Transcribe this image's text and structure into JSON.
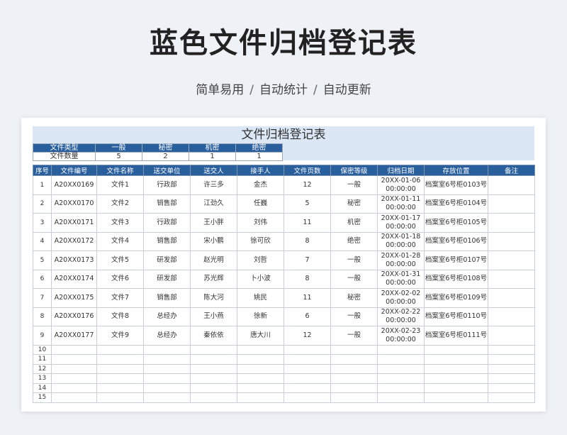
{
  "page_title": "蓝色文件归档登记表",
  "subtitle": [
    "简单易用",
    "自动统计",
    "自动更新"
  ],
  "subtitle_sep": "/",
  "sheet": {
    "banner": "文件归档登记表",
    "summary": {
      "header": [
        "文件类型",
        "一般",
        "秘密",
        "机密",
        "绝密"
      ],
      "values": [
        "文件数量",
        "5",
        "2",
        "1",
        "1"
      ]
    },
    "columns": [
      "序号",
      "文件编号",
      "文件名称",
      "送交单位",
      "送交人",
      "接手人",
      "文件页数",
      "保密等级",
      "归档日期",
      "存放位置",
      "备注"
    ],
    "rows": [
      [
        "1",
        "A20XX0169",
        "文件1",
        "行政部",
        "许三多",
        "金杰",
        "12",
        "一般",
        "20XX-01-06\n00:00:00",
        "档案室6号柜0103号",
        ""
      ],
      [
        "2",
        "A20XX0170",
        "文件2",
        "销售部",
        "江劲久",
        "任巍",
        "5",
        "秘密",
        "20XX-01-11\n00:00:00",
        "档案室6号柜0104号",
        ""
      ],
      [
        "3",
        "A20XX0171",
        "文件3",
        "行政部",
        "王小胖",
        "刘伟",
        "11",
        "机密",
        "20XX-01-17\n00:00:00",
        "档案室6号柜0105号",
        ""
      ],
      [
        "4",
        "A20XX0172",
        "文件4",
        "销售部",
        "宋小鹏",
        "徐可欣",
        "8",
        "绝密",
        "20XX-01-18\n00:00:00",
        "档案室6号柜0106号",
        ""
      ],
      [
        "5",
        "A20XX0173",
        "文件5",
        "研发部",
        "赵光明",
        "刘哲",
        "7",
        "一般",
        "20XX-01-28\n00:00:00",
        "档案室6号柜0107号",
        ""
      ],
      [
        "6",
        "A20XX0174",
        "文件6",
        "研发部",
        "苏光辉",
        "卜小波",
        "8",
        "一般",
        "20XX-01-31\n00:00:00",
        "档案室6号柜0108号",
        ""
      ],
      [
        "7",
        "A20XX0175",
        "文件7",
        "销售部",
        "陈大河",
        "姚民",
        "11",
        "秘密",
        "20XX-02-02\n00:00:00",
        "档案室6号柜0109号",
        ""
      ],
      [
        "8",
        "A20XX0176",
        "文件8",
        "总经办",
        "王小燕",
        "徐新",
        "6",
        "一般",
        "20XX-02-22\n00:00:00",
        "档案室6号柜0110号",
        ""
      ],
      [
        "9",
        "A20XX0177",
        "文件9",
        "总经办",
        "秦依依",
        "唐大川",
        "12",
        "一般",
        "20XX-02-23\n00:00:00",
        "档案室6号柜0111号",
        ""
      ]
    ],
    "empty_rows": [
      "10",
      "11",
      "12",
      "13",
      "14",
      "15"
    ]
  },
  "colors": {
    "header_blue": "#2a5f9e",
    "banner_bg": "#dbe7f5"
  }
}
